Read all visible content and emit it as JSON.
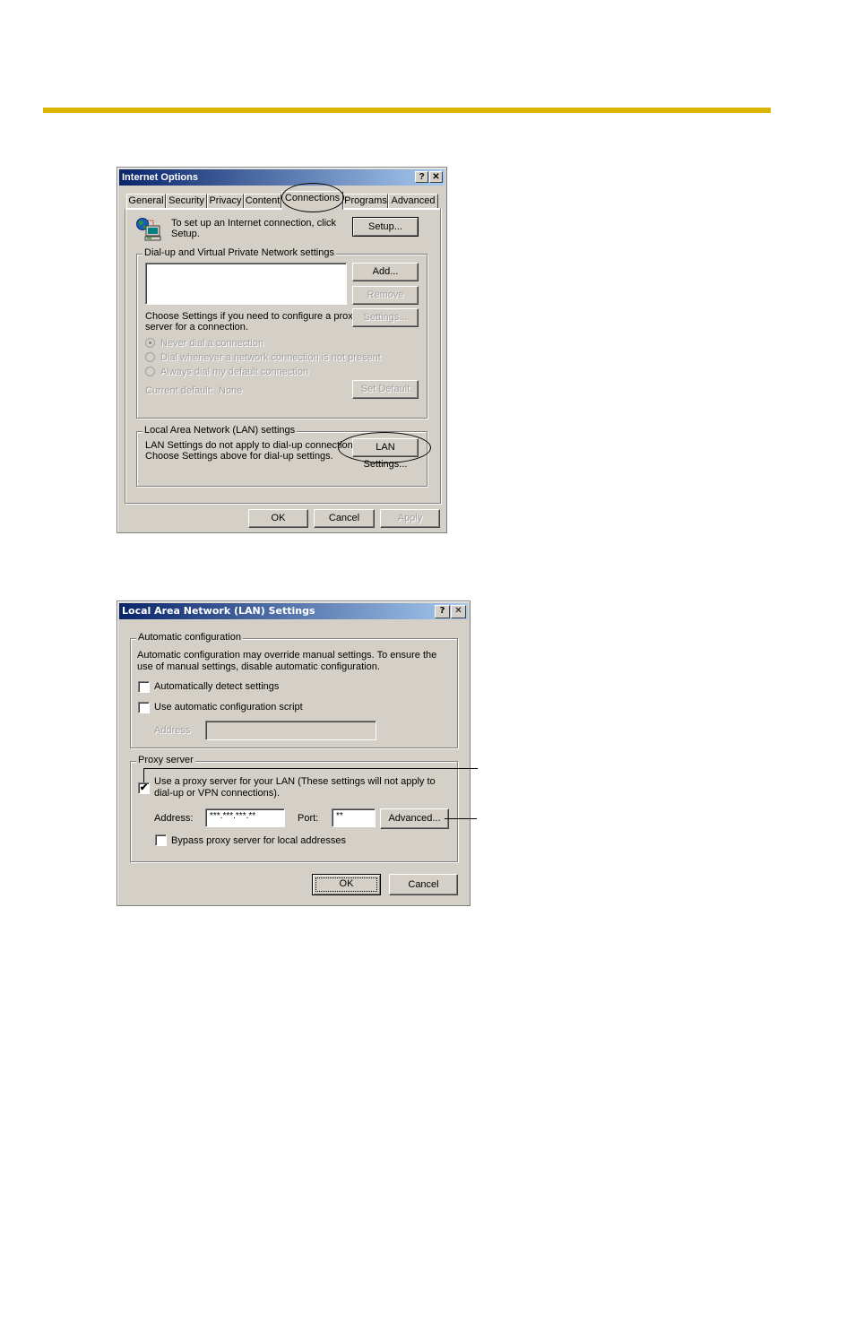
{
  "page": {
    "accent_rule_color": "#dbb400"
  },
  "internet_options": {
    "title": "Internet Options",
    "help_button": "?",
    "close_button": "✕",
    "tabs": [
      {
        "label": "General"
      },
      {
        "label": "Security"
      },
      {
        "label": "Privacy"
      },
      {
        "label": "Content"
      },
      {
        "label": "Connections",
        "active": true
      },
      {
        "label": "Programs"
      },
      {
        "label": "Advanced"
      }
    ],
    "setup_text": "To set up an Internet connection, click Setup.",
    "setup_text_line1": "To set up an Internet connection, click",
    "setup_text_line2": "Setup.",
    "setup_button": "Setup...",
    "dialup_group": {
      "label": "Dial-up and Virtual Private Network settings",
      "add_button": "Add...",
      "remove_button": "Remove",
      "settings_button": "Settings...",
      "settings_hint_line1": "Choose Settings if you need to configure a proxy",
      "settings_hint_line2": "server for a connection.",
      "radios": [
        {
          "label": "Never dial a connection",
          "selected": true
        },
        {
          "label": "Dial whenever a network connection is not present",
          "selected": false
        },
        {
          "label": "Always dial my default connection",
          "selected": false
        }
      ],
      "current_default_label": "Current default:",
      "current_default_value": "None",
      "set_default_button": "Set Default"
    },
    "lan_group": {
      "label": "Local Area Network (LAN) settings",
      "text_line1": "LAN Settings do not apply to dial-up connections.",
      "text_line2": "Choose Settings above for dial-up settings.",
      "lan_settings_button": "LAN Settings..."
    },
    "ok_button": "OK",
    "cancel_button": "Cancel",
    "apply_button": "Apply"
  },
  "lan_settings": {
    "title": "Local Area Network (LAN) Settings",
    "help_button": "?",
    "close_button": "✕",
    "auto_group": {
      "label": "Automatic configuration",
      "description_line1": "Automatic configuration may override manual settings.  To ensure the",
      "description_line2": "use of manual settings, disable automatic configuration.",
      "auto_detect_label": "Automatically detect settings",
      "auto_detect_checked": false,
      "auto_script_label": "Use automatic configuration script",
      "auto_script_checked": false,
      "address_label": "Address",
      "address_value": ""
    },
    "proxy_group": {
      "label": "Proxy server",
      "use_proxy_line1": "Use a proxy server for your LAN (These settings will not apply to",
      "use_proxy_line2": "dial-up or VPN connections).",
      "use_proxy_checked": true,
      "check_mark": "✔",
      "address_label": "Address:",
      "address_value": "***.***.***.**",
      "port_label": "Port:",
      "port_value": "**",
      "advanced_button": "Advanced...",
      "bypass_label": "Bypass proxy server for local addresses",
      "bypass_checked": false
    },
    "ok_button": "OK",
    "cancel_button": "Cancel"
  }
}
